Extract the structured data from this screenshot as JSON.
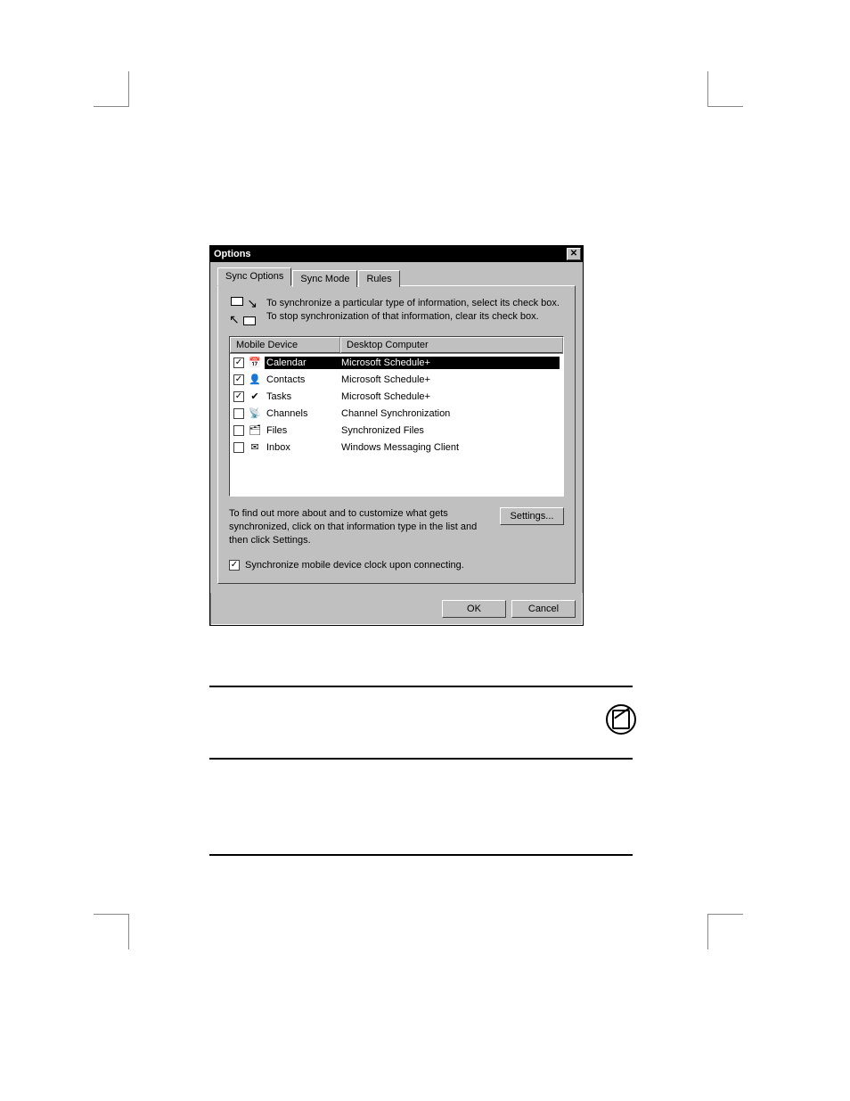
{
  "dialog": {
    "title": "Options",
    "tabs": [
      "Sync Options",
      "Sync Mode",
      "Rules"
    ],
    "active_tab": 0,
    "instructions": "To synchronize a particular type of information, select its check box. To stop synchronization of that information, clear its check box.",
    "columns": {
      "mobile": "Mobile Device",
      "desktop": "Desktop Computer"
    },
    "items": [
      {
        "checked": true,
        "icon": "calendar-icon",
        "label": "Calendar",
        "desktop": "Microsoft Schedule+",
        "selected": true
      },
      {
        "checked": true,
        "icon": "contacts-icon",
        "label": "Contacts",
        "desktop": "Microsoft Schedule+",
        "selected": false
      },
      {
        "checked": true,
        "icon": "tasks-icon",
        "label": "Tasks",
        "desktop": "Microsoft Schedule+",
        "selected": false
      },
      {
        "checked": false,
        "icon": "channels-icon",
        "label": "Channels",
        "desktop": "Channel Synchronization",
        "selected": false
      },
      {
        "checked": false,
        "icon": "files-icon",
        "label": "Files",
        "desktop": "Synchronized Files",
        "selected": false
      },
      {
        "checked": false,
        "icon": "inbox-icon",
        "label": "Inbox",
        "desktop": "Windows Messaging Client",
        "selected": false
      }
    ],
    "settings_text": "To find out more about and to customize what gets synchronized, click on that information type in the list and then click Settings.",
    "settings_button": "Settings...",
    "clock_checkbox": {
      "checked": true,
      "label": "Synchronize mobile device clock upon connecting."
    },
    "ok": "OK",
    "cancel": "Cancel"
  }
}
